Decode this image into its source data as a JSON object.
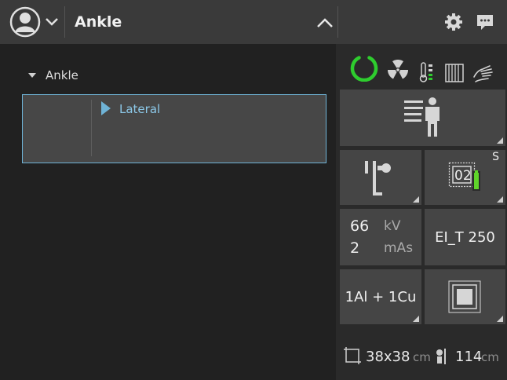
{
  "header": {
    "title": "Ankle",
    "icons": [
      "user-avatar-icon",
      "chevron-down-icon",
      "chevron-up-icon",
      "gear-icon",
      "chat-icon"
    ]
  },
  "tree": {
    "parent_label": "Ankle",
    "views": [
      {
        "label": "Lateral"
      }
    ]
  },
  "status_icons": [
    "ready-ring-icon",
    "radiation-icon",
    "temperature-icon",
    "grid-icon",
    "hand-icon"
  ],
  "colors": {
    "accent": "#6fb3d6",
    "ready": "#2ecc2e",
    "battery": "#5fd42a"
  },
  "exposure": {
    "kv_value": "66",
    "kv_unit": "kV",
    "mas_value": "2",
    "mas_unit": "mAs",
    "ei_label": "EI_T 250",
    "filter_label": "1Al + 1Cu",
    "detector_id": "02",
    "detector_badge": "S"
  },
  "footer": {
    "fov_value": "38x38",
    "fov_unit": "cm",
    "sid_value": "114",
    "sid_unit": "cm"
  }
}
